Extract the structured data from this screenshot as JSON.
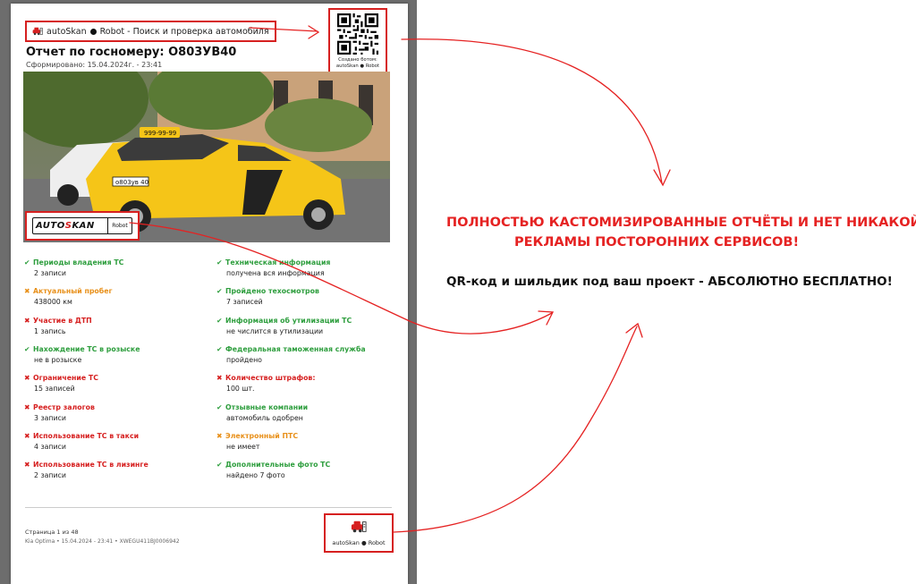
{
  "header": {
    "brand_left": "autoSkan",
    "brand_right": "Robot - Поиск и проверка автомобиля"
  },
  "report": {
    "title": "Отчет по госномеру: О803УВ40",
    "generated": "Сформировано: 15.04.2024г. - 23:41"
  },
  "qr": {
    "caption_line1": "Создано ботом:",
    "caption_line2": "autoSkan ● Robot"
  },
  "photo": {
    "plate_number": "о803ув 40",
    "taxi_phone": "999-99-99",
    "plate_frame_brand_a": "AUTO",
    "plate_frame_brand_s": "S",
    "plate_frame_brand_b": "KAN",
    "plate_frame_right": "Robot"
  },
  "items_left": [
    {
      "mark": "✔",
      "status": "ok",
      "title": "Периоды владения ТС",
      "value": "2 записи"
    },
    {
      "mark": "✖",
      "status": "warn",
      "title": "Актуальный пробег",
      "value": "438000 км"
    },
    {
      "mark": "✖",
      "status": "bad",
      "title": "Участие в ДТП",
      "value": "1 запись"
    },
    {
      "mark": "✔",
      "status": "ok",
      "title": "Нахождение ТС в розыске",
      "value": "не в розыске"
    },
    {
      "mark": "✖",
      "status": "bad",
      "title": "Ограничение ТС",
      "value": "15 записей"
    },
    {
      "mark": "✖",
      "status": "bad",
      "title": "Реестр залогов",
      "value": "3 записи"
    },
    {
      "mark": "✖",
      "status": "bad",
      "title": "Использование ТС в такси",
      "value": "4 записи"
    },
    {
      "mark": "✖",
      "status": "bad",
      "title": "Использование ТС в лизинге",
      "value": "2 записи"
    }
  ],
  "items_right": [
    {
      "mark": "✔",
      "status": "ok",
      "title": "Техническая информация",
      "value": "получена вся информация"
    },
    {
      "mark": "✔",
      "status": "ok",
      "title": "Пройдено техосмотров",
      "value": "7 записей"
    },
    {
      "mark": "✔",
      "status": "ok",
      "title": "Информация об утилизации ТС",
      "value": "не числится в утилизации"
    },
    {
      "mark": "✔",
      "status": "ok",
      "title": "Федеральная таможенная служба",
      "value": "пройдено"
    },
    {
      "mark": "✖",
      "status": "bad",
      "title": "Количество штрафов:",
      "value": "100 шт."
    },
    {
      "mark": "✔",
      "status": "ok",
      "title": "Отзывные компании",
      "value": "автомобиль одобрен"
    },
    {
      "mark": "✖",
      "status": "warn",
      "title": "Электронный ПТС",
      "value": "не имеет"
    },
    {
      "mark": "✔",
      "status": "ok",
      "title": "Дополнительные фото ТС",
      "value": "найдено 7 фото"
    }
  ],
  "footer": {
    "page": "Страница 1 из 48",
    "meta": "Kia Optima • 15.04.2024 - 23:41 • XWEGU411BJ0006942",
    "logo_text": "autoSkan ● Robot"
  },
  "promo": {
    "line1": "ПОЛНОСТЬЮ КАСТОМИЗИРОВАННЫЕ ОТЧЁТЫ И НЕТ НИКАКОЙ",
    "line2": "РЕКЛАМЫ ПОСТОРОННИХ СЕРВИСОВ!",
    "line3": "QR-код и шильдик под ваш проект - АБСОЛЮТНО БЕСПЛАТНО!"
  },
  "colors": {
    "ok": "#2e9e3e",
    "warn": "#e8901a",
    "bad": "#d62020",
    "accent_red": "#e52222"
  }
}
